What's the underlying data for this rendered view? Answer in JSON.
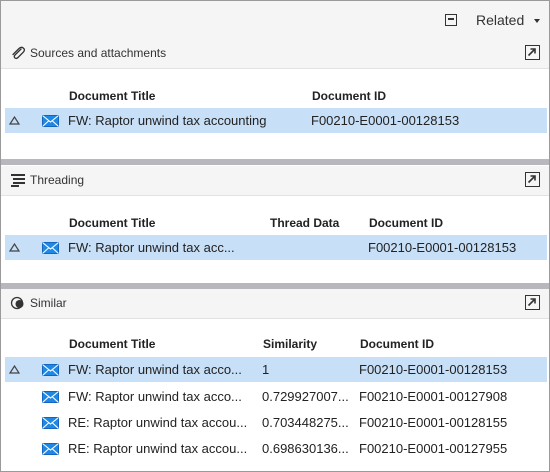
{
  "header": {
    "related_label": "Related",
    "collapse_icon": "collapse-icon",
    "dropdown_icon": "chevron-down-icon"
  },
  "panels": {
    "sources": {
      "title": "Sources and attachments",
      "icon": "paperclip-icon",
      "columns": {
        "title": "Document Title",
        "id": "Document ID"
      },
      "rows": [
        {
          "title": "FW: Raptor unwind tax accounting",
          "id": "F00210-E0001-00128153",
          "selected": true
        }
      ]
    },
    "threading": {
      "title": "Threading",
      "icon": "threading-icon",
      "columns": {
        "title": "Document Title",
        "thread": "Thread Data",
        "id": "Document ID"
      },
      "rows": [
        {
          "title": "FW: Raptor unwind tax acc...",
          "thread": "",
          "id": "F00210-E0001-00128153",
          "selected": true
        }
      ]
    },
    "similar": {
      "title": "Similar",
      "icon": "similar-icon",
      "columns": {
        "title": "Document Title",
        "similarity": "Similarity",
        "id": "Document ID"
      },
      "rows": [
        {
          "title": "FW: Raptor unwind tax acco...",
          "similarity": "1",
          "id": "F00210-E0001-00128153",
          "selected": true
        },
        {
          "title": "FW: Raptor unwind tax acco...",
          "similarity": "0.729927007...",
          "id": "F00210-E0001-00127908",
          "selected": false
        },
        {
          "title": "RE: Raptor unwind tax accou...",
          "similarity": "0.703448275...",
          "id": "F00210-E0001-00128155",
          "selected": false
        },
        {
          "title": "RE: Raptor unwind tax accou...",
          "similarity": "0.698630136...",
          "id": "F00210-E0001-00127955",
          "selected": false
        }
      ]
    }
  },
  "colors": {
    "selected_row": "#c7dff7",
    "divider": "#b7b7bd",
    "mail_icon": "#1e88e5"
  }
}
